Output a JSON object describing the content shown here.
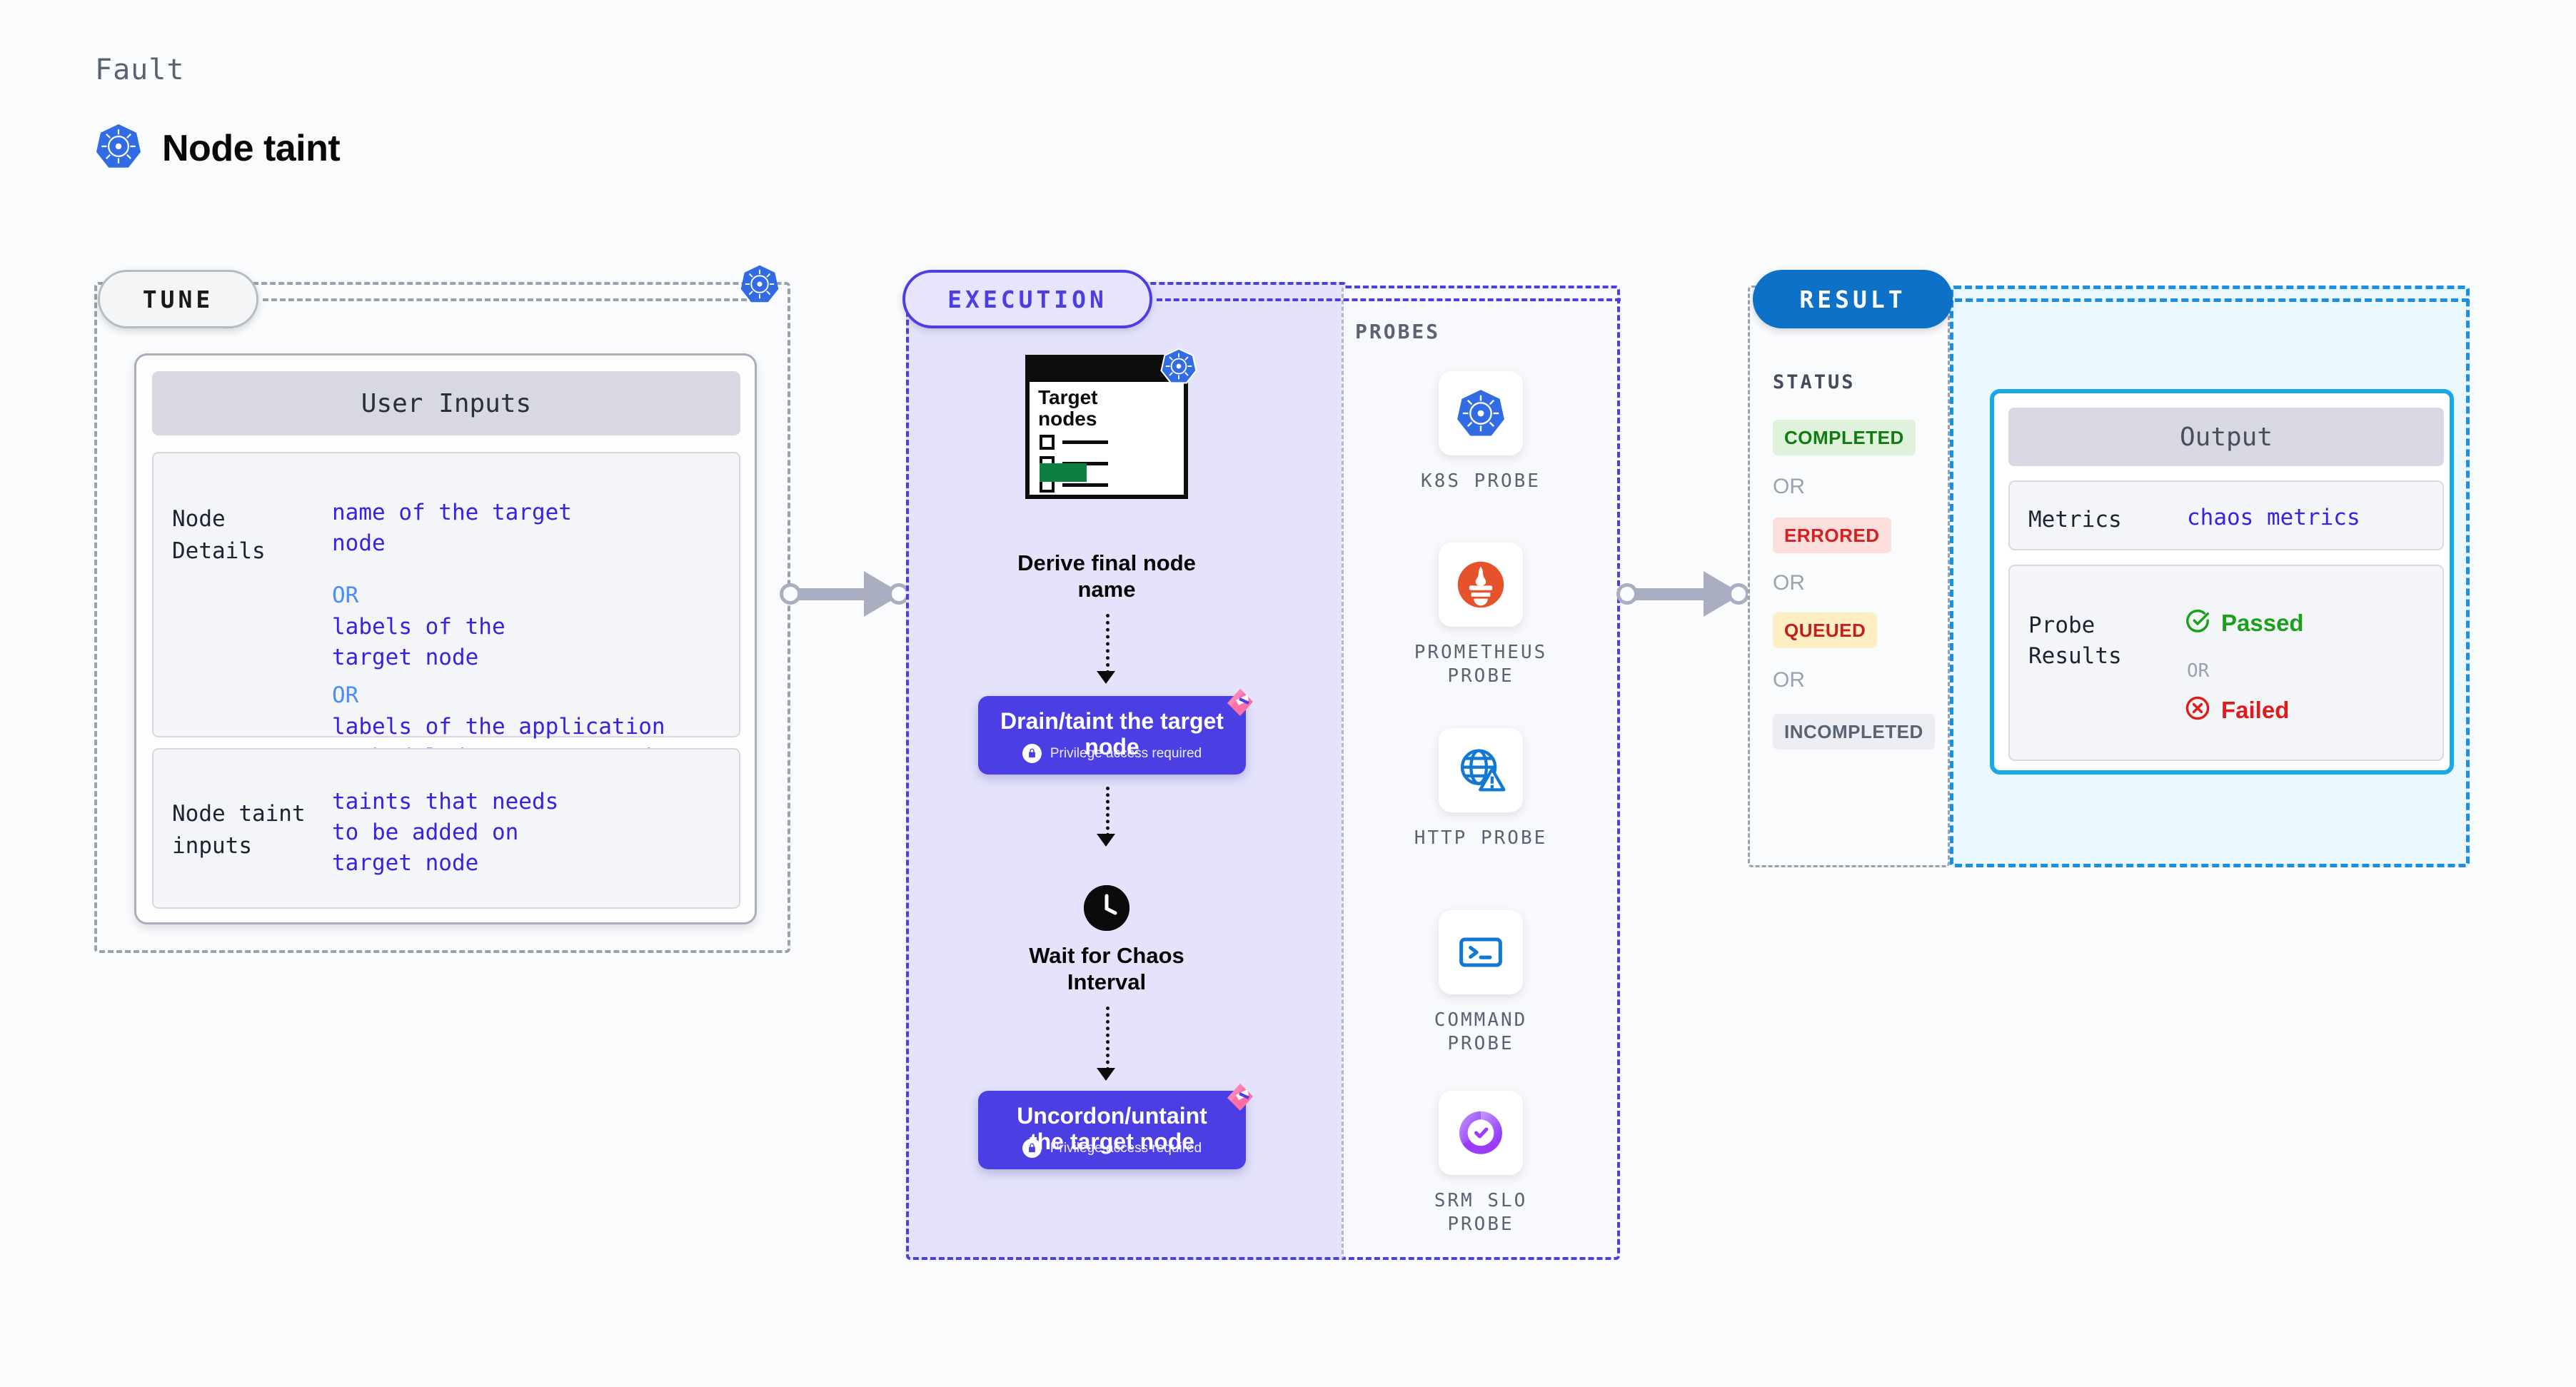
{
  "header": {
    "kicker": "Fault",
    "title": "Node taint",
    "icon": "kubernetes-icon"
  },
  "tune": {
    "pill": "TUNE",
    "card_title": "User Inputs",
    "rows": [
      {
        "key": "Node Details",
        "lines": [
          "name of the target",
          "node",
          "OR",
          "labels of the",
          "target node",
          "OR",
          "labels of the application",
          " scheduled on target node"
        ]
      },
      {
        "key": "Node taint inputs",
        "lines": [
          "taints that needs",
          "to be added on",
          "target node"
        ]
      }
    ],
    "node_details_key": "Node Details",
    "node_details_v1": "name of the target\nnode",
    "or1": "OR",
    "node_details_v2": "labels of the\ntarget node",
    "or2": "OR",
    "node_details_v3": "labels of the application\n scheduled on target node",
    "node_taint_key": "Node taint\ninputs",
    "node_taint_val": "taints that needs\nto be added on\ntarget node"
  },
  "execution": {
    "pill": "EXECUTION",
    "steps": [
      {
        "icon": "target-nodes-document-icon",
        "doc_title": "Target\nnodes",
        "label": "Derive final node\nname",
        "type": "icon"
      },
      {
        "label": "Drain/taint the target\nnode",
        "privilege": "Privilege access required",
        "type": "action"
      },
      {
        "icon": "clock-icon",
        "label": "Wait for Chaos\nInterval",
        "type": "icon"
      },
      {
        "label": "Uncordon/untaint\nthe target node",
        "privilege": "Privilege access required",
        "type": "action"
      }
    ],
    "doc_title_line1": "Target",
    "doc_title_line2": "nodes",
    "step1_label": "Derive final node\nname",
    "step2_label": "Drain/taint the target\nnode",
    "step2_priv": "Privilege access required",
    "step3_label": "Wait for Chaos\nInterval",
    "step4_label": "Uncordon/untaint\nthe target node",
    "step4_priv": "Privilege access required"
  },
  "probes": {
    "title": "PROBES",
    "items": [
      {
        "label": "K8S PROBE",
        "icon": "kubernetes-icon"
      },
      {
        "label": "PROMETHEUS\nPROBE",
        "icon": "prometheus-icon"
      },
      {
        "label": "HTTP PROBE",
        "icon": "http-globe-icon"
      },
      {
        "label": "COMMAND\nPROBE",
        "icon": "terminal-icon"
      },
      {
        "label": "SRM SLO\nPROBE",
        "icon": "srm-slo-icon"
      }
    ],
    "p1": "K8S PROBE",
    "p2": "PROMETHEUS\nPROBE",
    "p3": "HTTP PROBE",
    "p4": "COMMAND\nPROBE",
    "p5": "SRM SLO\nPROBE"
  },
  "result": {
    "pill": "RESULT",
    "status_label": "STATUS",
    "statuses": [
      {
        "label": "COMPLETED",
        "bg": "#dff3dc",
        "fg": "#107c10"
      },
      {
        "label": "ERRORED",
        "bg": "#fcdedd",
        "fg": "#d32020"
      },
      {
        "label": "QUEUED",
        "bg": "#fdeec4",
        "fg": "#c21f1f"
      },
      {
        "label": "INCOMPLETED",
        "bg": "#eceef3",
        "fg": "#5a6372"
      }
    ],
    "or": "OR",
    "s1": "COMPLETED",
    "s2": "ERRORED",
    "s3": "QUEUED",
    "s4": "INCOMPLETED",
    "output_title": "Output",
    "metrics_key": "Metrics",
    "metrics_val": "chaos metrics",
    "probe_results_key": "Probe\nResults",
    "passed": "Passed",
    "failed": "Failed",
    "probe_or": "OR"
  },
  "colors": {
    "accent_purple": "#4b3fe4",
    "accent_blue": "#0d71c8",
    "k8s_blue": "#326ce5",
    "ribbon_pink": "#ff6fa5",
    "pass_green": "#1aa01a",
    "fail_red": "#e01b1b"
  }
}
